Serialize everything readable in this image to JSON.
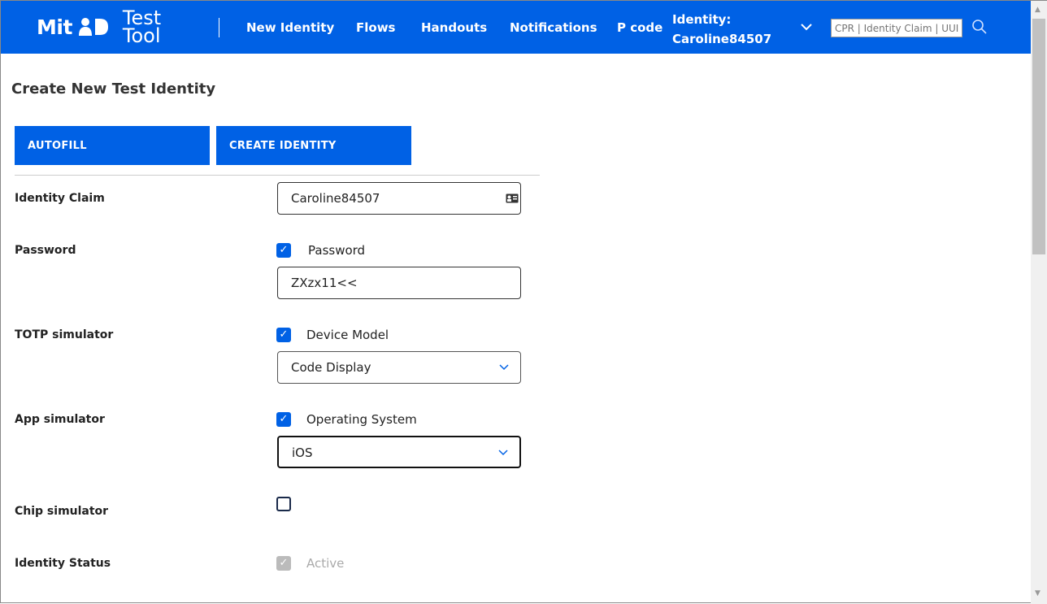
{
  "header": {
    "logo_mit": "Mit",
    "logo_test": "Test",
    "logo_tool": "Tool",
    "nav": [
      "New Identity",
      "Flows",
      "Handouts",
      "Notifications",
      "P code"
    ],
    "identity_label": "Identity:",
    "identity_value": "Caroline84507",
    "search_placeholder": "CPR | Identity Claim | UUID"
  },
  "page": {
    "title": "Create New Test Identity",
    "autofill": "AUTOFILL",
    "create": "CREATE IDENTITY"
  },
  "form": {
    "identity_claim": {
      "label": "Identity Claim",
      "value": "Caroline84507"
    },
    "password": {
      "label": "Password",
      "checkbox": "Password",
      "checked": true,
      "value": "ZXzx11<<"
    },
    "totp": {
      "label": "TOTP simulator",
      "checkbox": "Device Model",
      "checked": true,
      "value": "Code Display"
    },
    "app": {
      "label": "App simulator",
      "checkbox": "Operating System",
      "checked": true,
      "value": "iOS"
    },
    "chip": {
      "label": "Chip simulator",
      "checked": false
    },
    "status": {
      "label": "Identity Status",
      "checkbox": "Active",
      "checked": true,
      "disabled": true
    }
  }
}
